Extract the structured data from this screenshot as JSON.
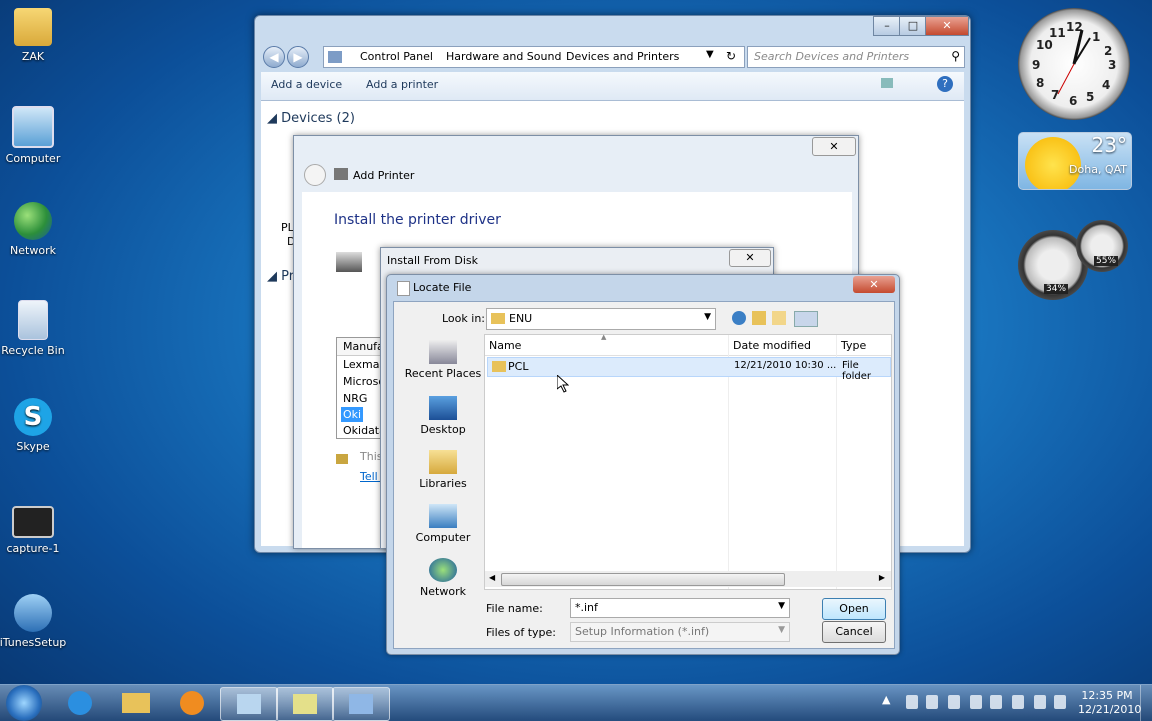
{
  "desktop": {
    "icons": [
      {
        "label": "ZAK"
      },
      {
        "label": "Computer"
      },
      {
        "label": "Network"
      },
      {
        "label": "Recycle Bin"
      },
      {
        "label": "Skype"
      },
      {
        "label": "capture-1"
      },
      {
        "label": "iTunesSetup"
      }
    ]
  },
  "gadgets": {
    "clock_numbers": [
      "12",
      "1",
      "2",
      "3",
      "4",
      "5",
      "6",
      "7",
      "8",
      "9",
      "10",
      "11"
    ],
    "weather": {
      "temp": "23°",
      "city": "Doha, QAT"
    },
    "meters": {
      "cpu": "34%",
      "ram": "55%"
    }
  },
  "explorer": {
    "breadcrumb": [
      "Control Panel",
      "Hardware and Sound",
      "Devices and Printers"
    ],
    "search_placeholder": "Search Devices and Printers",
    "toolbar": {
      "add_device": "Add a device",
      "add_printer": "Add a printer"
    },
    "devices_header": "Devices (2)",
    "printers_header_partial": "Pri",
    "device_labels_partial": [
      "PL",
      "D"
    ]
  },
  "add_printer": {
    "title": "Add Printer",
    "heading": "Install the printer driver",
    "manufacturer_header": "Manufa",
    "manufacturers": [
      "Lexmark",
      "Microso",
      "NRG",
      "Oki",
      "Okidata"
    ],
    "selected_manufacturer": "Oki",
    "signed_text": "This",
    "tell_me": "Tell m"
  },
  "install_disk": {
    "title": "Install From Disk"
  },
  "locate_file": {
    "title": "Locate File",
    "look_in_label": "Look in:",
    "look_in_value": "ENU",
    "places": [
      "Recent Places",
      "Desktop",
      "Libraries",
      "Computer",
      "Network"
    ],
    "columns": {
      "name": "Name",
      "date": "Date modified",
      "type": "Type"
    },
    "rows": [
      {
        "name": "PCL",
        "date": "12/21/2010 10:30 ...",
        "type": "File folder"
      }
    ],
    "file_name_label": "File name:",
    "file_name_value": "*.inf",
    "files_of_type_label": "Files of type:",
    "files_of_type_value": "Setup Information (*.inf)",
    "open_button": "Open",
    "cancel_button": "Cancel"
  },
  "taskbar": {
    "time": "12:35 PM",
    "date": "12/21/2010"
  }
}
